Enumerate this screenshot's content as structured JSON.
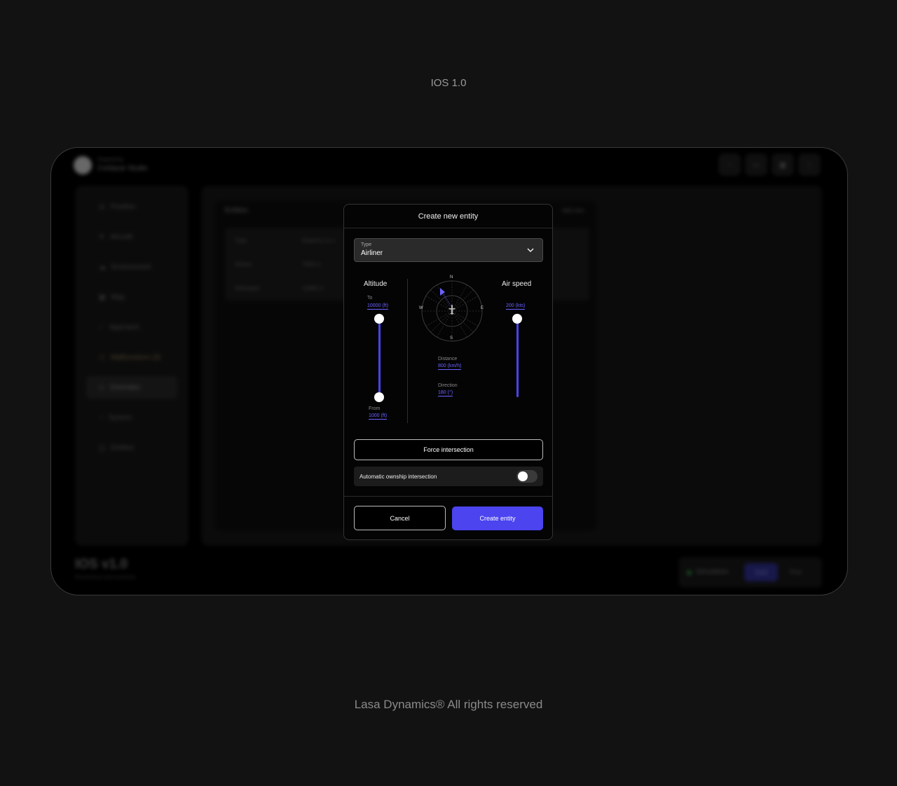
{
  "page": {
    "title": "IOS 1.0",
    "footer": "Lasa Dynamics®  All rights reserved"
  },
  "background_app": {
    "brand_small": "Powered by",
    "brand": "Coritacar Studio",
    "sidebar": [
      {
        "label": "Position",
        "icon": "target-icon"
      },
      {
        "label": "Aircraft",
        "icon": "plane-icon"
      },
      {
        "label": "Environment",
        "icon": "cloud-icon"
      },
      {
        "label": "Map",
        "icon": "map-icon"
      },
      {
        "label": "Approach",
        "icon": "approach-icon"
      },
      {
        "label": "Malfunctions (3)",
        "icon": "warning-icon"
      },
      {
        "label": "Overrides",
        "icon": "override-icon"
      },
      {
        "label": "System",
        "icon": "system-icon"
      },
      {
        "label": "Entities",
        "icon": "entities-icon"
      }
    ],
    "panel_title": "Entities",
    "add_new": "Add new",
    "table_headers": [
      "Type",
      "Distance to o"
    ],
    "table_rows": [
      [
        "Airliner",
        "7500 m"
      ],
      [
        "Helicopter",
        "12000 m"
      ]
    ],
    "product_name": "IOS v1.0",
    "powered_by": "Powered by Lasa Dynamics",
    "sim_label": "Simulation",
    "sim_start": "Start",
    "sim_stop": "Stop"
  },
  "modal": {
    "title": "Create new entity",
    "type": {
      "label": "Type",
      "value": "Airliner"
    },
    "altitude": {
      "label": "Altitude",
      "to_label": "To",
      "to_value": "10000 (ft)",
      "from_label": "From",
      "from_value": "1000 (ft)"
    },
    "compass": {
      "n": "N",
      "s": "S",
      "e": "E",
      "w": "W"
    },
    "distance": {
      "label": "Distance",
      "value": "800 (km/h)"
    },
    "direction": {
      "label": "Direction",
      "value": "180 (°)"
    },
    "airspeed": {
      "label": "Air speed",
      "value": "200 (kts)"
    },
    "force_intersection": "Force intersection",
    "auto_intersection": {
      "label": "Automatic ownship intersection",
      "enabled": false
    },
    "cancel": "Cancel",
    "create": "Create entity"
  },
  "colors": {
    "accent": "#4b44ef",
    "background": "#121212",
    "link": "#6a63ff"
  }
}
